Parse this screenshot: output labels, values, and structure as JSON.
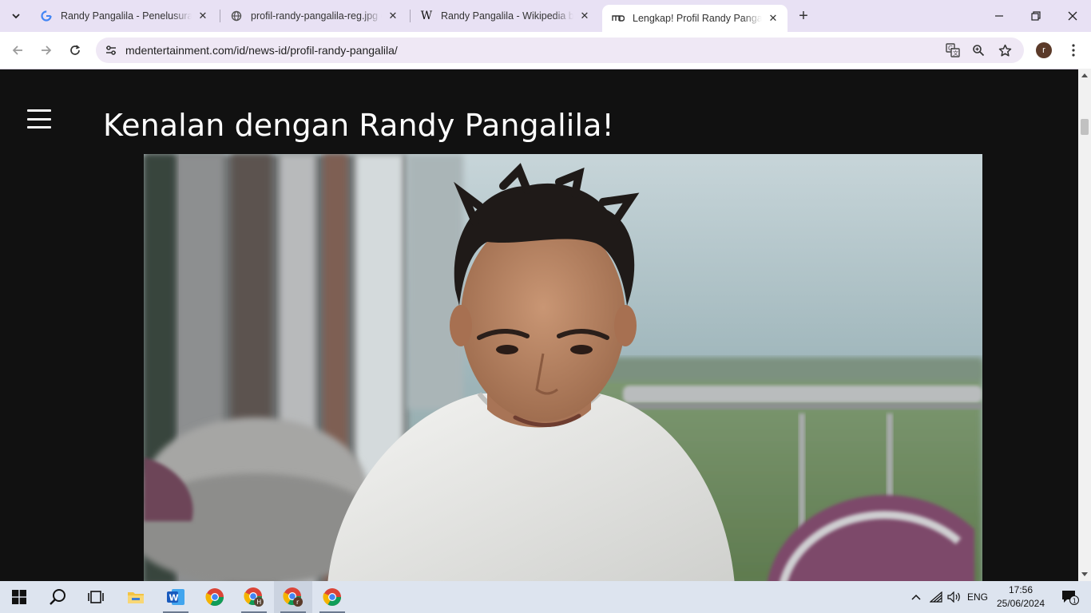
{
  "browser": {
    "tabs": [
      {
        "title": "Randy Pangalila - Penelusuran Google",
        "favicon": "google-icon",
        "active": false
      },
      {
        "title": "profil-randy-pangalila-reg.jpg (",
        "favicon": "globe-icon",
        "active": false
      },
      {
        "title": "Randy Pangalila - Wikipedia bahasa Indonesia",
        "favicon": "wikipedia-icon",
        "active": false
      },
      {
        "title": "Lengkap! Profil Randy Pangalila",
        "favicon": "md-logo-icon",
        "active": true
      }
    ],
    "url": "mdentertainment.com/id/news-id/profil-randy-pangalila/",
    "profile_initial": "r"
  },
  "page": {
    "title": "Kenalan dengan Randy Pangalila!",
    "background": "#111111"
  },
  "taskbar": {
    "apps": [
      {
        "name": "file-explorer",
        "running": false
      },
      {
        "name": "word",
        "running": true
      },
      {
        "name": "chrome",
        "running": false
      },
      {
        "name": "chrome-profile-h",
        "badge": "H",
        "running": true
      },
      {
        "name": "chrome-profile-r",
        "badge": "r",
        "running": true
      },
      {
        "name": "chrome-2",
        "running": true
      }
    ],
    "language": "ENG",
    "time": "17:56",
    "date": "25/06/2024",
    "notification_count": "1"
  }
}
